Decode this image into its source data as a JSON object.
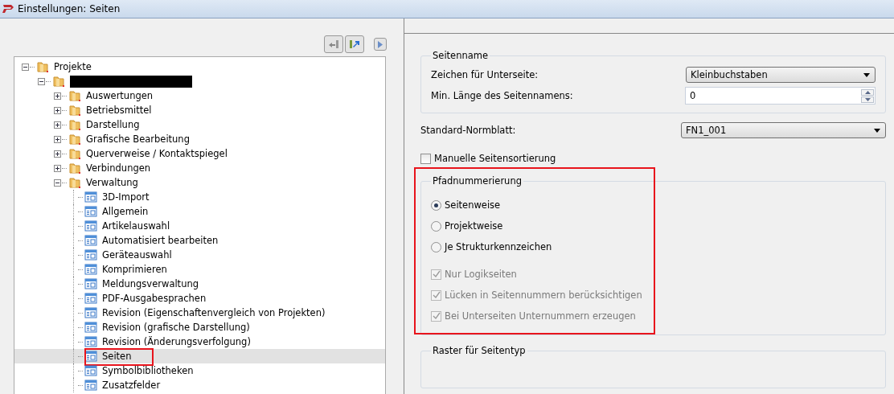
{
  "window": {
    "title": "Einstellungen: Seiten"
  },
  "tree": [
    {
      "kind": "folder",
      "label": "Projekte",
      "expanded": true,
      "selected": false,
      "highlighted": false,
      "children": [
        {
          "kind": "redacted",
          "expanded": true,
          "selected": false,
          "highlighted": false,
          "children": [
            {
              "kind": "folder",
              "label": "Auswertungen",
              "expanded": false,
              "selected": false,
              "highlighted": false
            },
            {
              "kind": "folder",
              "label": "Betriebsmittel",
              "expanded": false,
              "selected": false,
              "highlighted": false
            },
            {
              "kind": "folder",
              "label": "Darstellung",
              "expanded": false,
              "selected": false,
              "highlighted": false
            },
            {
              "kind": "folder",
              "label": "Grafische Bearbeitung",
              "expanded": false,
              "selected": false,
              "highlighted": false
            },
            {
              "kind": "folder",
              "label": "Querverweise / Kontaktspiegel",
              "expanded": false,
              "selected": false,
              "highlighted": false
            },
            {
              "kind": "folder",
              "label": "Verbindungen",
              "expanded": false,
              "selected": false,
              "highlighted": false
            },
            {
              "kind": "folder",
              "label": "Verwaltung",
              "expanded": true,
              "selected": false,
              "highlighted": false,
              "children": [
                {
                  "kind": "page",
                  "label": "3D-Import",
                  "selected": false,
                  "highlighted": false
                },
                {
                  "kind": "page",
                  "label": "Allgemein",
                  "selected": false,
                  "highlighted": false
                },
                {
                  "kind": "page",
                  "label": "Artikelauswahl",
                  "selected": false,
                  "highlighted": false
                },
                {
                  "kind": "page",
                  "label": "Automatisiert bearbeiten",
                  "selected": false,
                  "highlighted": false
                },
                {
                  "kind": "page",
                  "label": "Geräteauswahl",
                  "selected": false,
                  "highlighted": false
                },
                {
                  "kind": "page",
                  "label": "Komprimieren",
                  "selected": false,
                  "highlighted": false
                },
                {
                  "kind": "page",
                  "label": "Meldungsverwaltung",
                  "selected": false,
                  "highlighted": false
                },
                {
                  "kind": "page",
                  "label": "PDF-Ausgabesprachen",
                  "selected": false,
                  "highlighted": false
                },
                {
                  "kind": "page",
                  "label": "Revision (Eigenschaftenvergleich von Projekten)",
                  "selected": false,
                  "highlighted": false
                },
                {
                  "kind": "page",
                  "label": "Revision (grafische Darstellung)",
                  "selected": false,
                  "highlighted": false
                },
                {
                  "kind": "page",
                  "label": "Revision (Änderungsverfolgung)",
                  "selected": false,
                  "highlighted": false
                },
                {
                  "kind": "page",
                  "label": "Seiten",
                  "selected": true,
                  "highlighted": true
                },
                {
                  "kind": "page",
                  "label": "Symbolbibliotheken",
                  "selected": false,
                  "highlighted": false
                },
                {
                  "kind": "page",
                  "label": "Zusatzfelder",
                  "selected": false,
                  "highlighted": false
                }
              ]
            }
          ]
        }
      ]
    }
  ],
  "seitenname": {
    "title": "Seitenname",
    "zeichen": {
      "label": "Zeichen für Unterseite:",
      "value": "Kleinbuchstaben"
    },
    "min_laenge": {
      "label": "Min. Länge des Seitennamens:",
      "value": "0"
    }
  },
  "normblatt": {
    "label": "Standard-Normblatt:",
    "value": "FN1_001"
  },
  "manuelle_sortierung": {
    "label": "Manuelle Seitensortierung",
    "checked": false,
    "disabled": false
  },
  "pfadnummerierung": {
    "title": "Pfadnummerierung",
    "highlighted": true,
    "radios": [
      {
        "label": "Seitenweise",
        "selected": true
      },
      {
        "label": "Projektweise",
        "selected": false
      },
      {
        "label": "Je Strukturkennzeichen",
        "selected": false
      }
    ],
    "checkboxes": [
      {
        "label": "Nur Logikseiten",
        "checked": true,
        "disabled": true
      },
      {
        "label": "Lücken in Seitennummern berücksichtigen",
        "checked": true,
        "disabled": true
      },
      {
        "label": "Bei Unterseiten Unternummern erzeugen",
        "checked": true,
        "disabled": true
      }
    ]
  },
  "raster": {
    "title": "Raster für Seitentyp"
  }
}
